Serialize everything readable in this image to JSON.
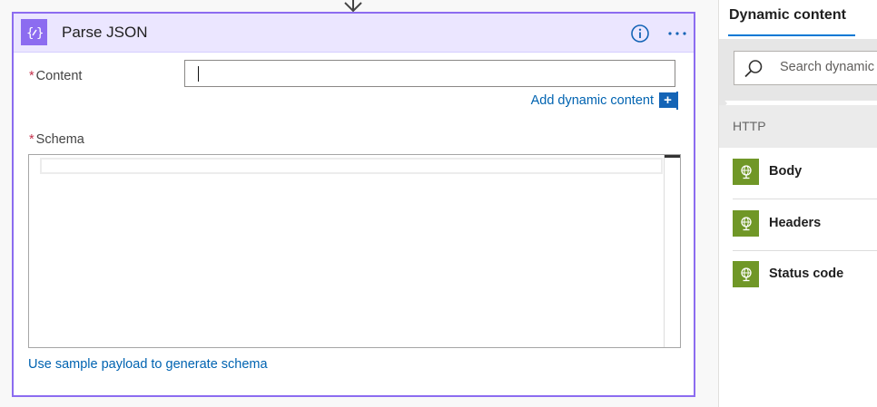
{
  "card": {
    "title": "Parse JSON",
    "icon": "parse-json-icon",
    "accent_color": "#8c6cf0",
    "header_color": "#ebe6ff"
  },
  "content_field": {
    "required_marker": "*",
    "label": "Content",
    "value": ""
  },
  "add_dynamic": {
    "label": "Add dynamic content",
    "button_glyph": "+"
  },
  "schema_field": {
    "required_marker": "*",
    "label": "Schema",
    "value": ""
  },
  "sample_link": "Use sample payload to generate schema",
  "panel": {
    "tab_label": "Dynamic content",
    "search_placeholder": "Search dynamic content",
    "section_label": "HTTP",
    "items": [
      {
        "label": "Body",
        "icon": "http-globe-icon"
      },
      {
        "label": "Headers",
        "icon": "http-globe-icon"
      },
      {
        "label": "Status code",
        "icon": "http-globe-icon"
      }
    ],
    "http_color": "#709727",
    "link_color": "#0063b1"
  }
}
